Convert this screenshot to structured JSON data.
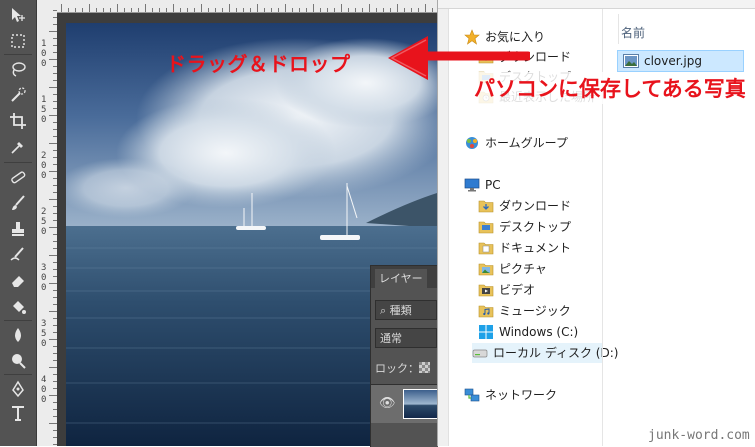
{
  "photoshop": {
    "ruler_labels": [
      "1",
      "0",
      "0",
      "1",
      "5",
      "0",
      "2",
      "0",
      "0",
      "2",
      "5",
      "0",
      "3",
      "0",
      "0",
      "3",
      "5",
      "0",
      "4",
      "0",
      "0"
    ],
    "tools": [
      "move-tool",
      "marquee-tool",
      "lasso-tool",
      "quick-selection-tool",
      "crop-tool",
      "eyedropper-tool",
      "healing-brush-tool",
      "brush-tool",
      "clone-stamp-tool",
      "history-brush-tool",
      "eraser-tool",
      "paint-bucket-tool",
      "blur-tool",
      "dodge-tool",
      "pen-tool",
      "type-tool"
    ],
    "layers_panel": {
      "tab_label": "レイヤー",
      "search_label": "種類",
      "blend_mode": "通常",
      "lock_label": "ロック："
    }
  },
  "explorer": {
    "nav_items": [
      {
        "label": "お気に入り",
        "icon": "star-icon"
      },
      {
        "label": "ダウンロード",
        "icon": "download-folder-icon"
      },
      {
        "label": "デスクトップ",
        "icon": "desktop-folder-icon"
      },
      {
        "label": "最近表示した場所",
        "icon": "recent-places-icon"
      },
      {
        "label": "ホームグループ",
        "icon": "homegroup-icon"
      },
      {
        "label": "PC",
        "icon": "pc-icon"
      },
      {
        "label": "ダウンロード",
        "icon": "download-folder-icon"
      },
      {
        "label": "デスクトップ",
        "icon": "desktop-folder-icon"
      },
      {
        "label": "ドキュメント",
        "icon": "documents-folder-icon"
      },
      {
        "label": "ピクチャ",
        "icon": "pictures-folder-icon"
      },
      {
        "label": "ビデオ",
        "icon": "videos-folder-icon"
      },
      {
        "label": "ミュージック",
        "icon": "music-folder-icon"
      },
      {
        "label": "Windows (C:)",
        "icon": "windows-drive-icon"
      },
      {
        "label": "ローカル ディスク (D:)",
        "icon": "local-disk-icon"
      },
      {
        "label": "ネットワーク",
        "icon": "network-icon"
      }
    ],
    "column_header": "名前",
    "file_name": "clover.jpg"
  },
  "annotations": {
    "drag_drop": "ドラッグ＆ドロップ",
    "pc_photo": "パソコンに保存してある写真"
  },
  "watermark": "junk-word.com",
  "colors": {
    "annotation": "#e8131c",
    "selection": "#cce8ff"
  }
}
